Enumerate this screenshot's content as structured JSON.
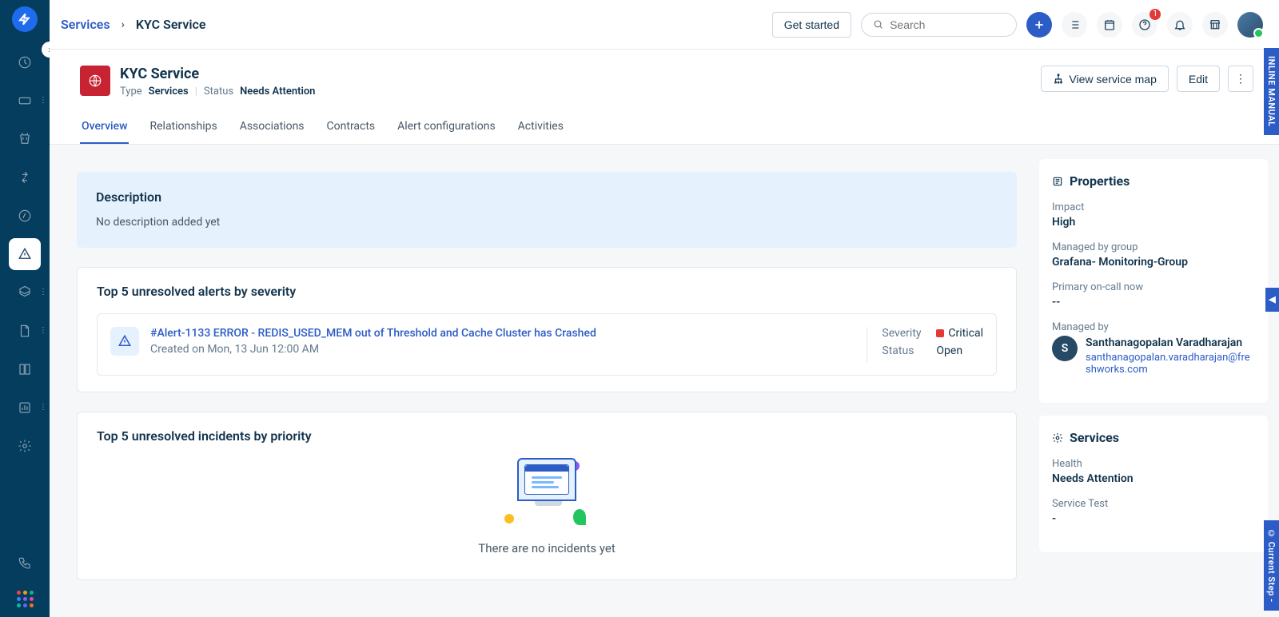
{
  "breadcrumb": {
    "root": "Services",
    "current": "KYC Service"
  },
  "topbar": {
    "get_started": "Get started",
    "search_placeholder": "Search",
    "help_badge": "1"
  },
  "page": {
    "title": "KYC Service",
    "type_label": "Type",
    "type_value": "Services",
    "status_label": "Status",
    "status_value": "Needs Attention",
    "view_map": "View service map",
    "edit": "Edit"
  },
  "tabs": [
    "Overview",
    "Relationships",
    "Associations",
    "Contracts",
    "Alert configurations",
    "Activities"
  ],
  "description": {
    "heading": "Description",
    "text": "No description added yet"
  },
  "alerts": {
    "heading": "Top 5 unresolved alerts by severity",
    "item": {
      "title": "#Alert-1133 ERROR - REDIS_USED_MEM out of Threshold and Cache Cluster has Crashed",
      "created": "Created on Mon, 13 Jun 12:00 AM",
      "severity_label": "Severity",
      "severity_value": "Critical",
      "status_label": "Status",
      "status_value": "Open"
    }
  },
  "incidents": {
    "heading": "Top 5 unresolved incidents by priority",
    "empty": "There are no incidents yet"
  },
  "properties": {
    "heading": "Properties",
    "impact_label": "Impact",
    "impact_value": "High",
    "group_label": "Managed by group",
    "group_value": "Grafana- Monitoring-Group",
    "oncall_label": "Primary on-call now",
    "oncall_value": "--",
    "managed_by_label": "Managed by",
    "managed_by_initial": "S",
    "managed_by_name": "Santhanagopalan Varadharajan",
    "managed_by_email": "santhanagopalan.varadharajan@freshworks.com"
  },
  "services": {
    "heading": "Services",
    "health_label": "Health",
    "health_value": "Needs Attention",
    "test_label": "Service Test",
    "test_value": "-"
  },
  "side_tabs": {
    "manual": "INLINE MANUAL",
    "step": "© Current Step -"
  }
}
